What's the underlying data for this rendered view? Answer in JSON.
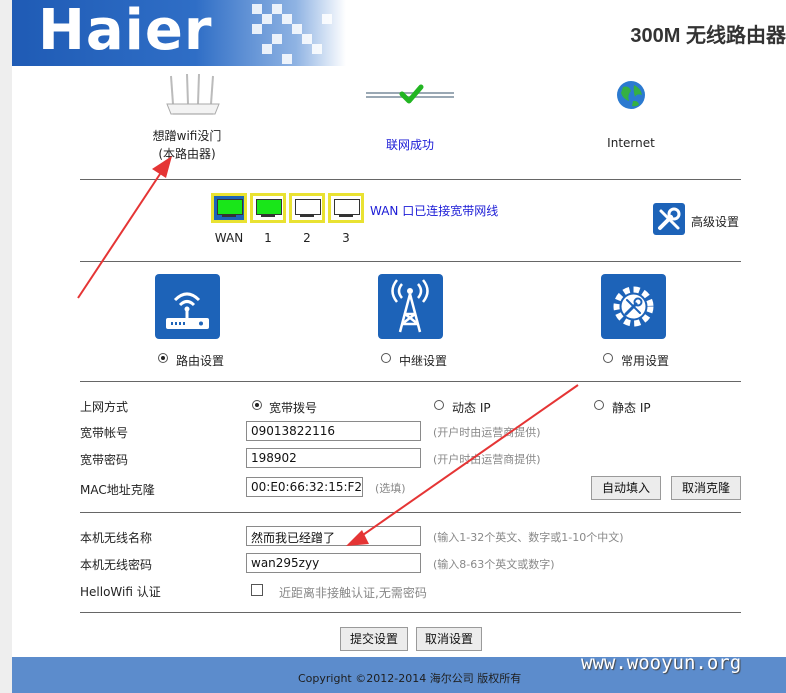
{
  "header": {
    "logo_text": "Haier",
    "product_title": "300M 无线路由器"
  },
  "topology": {
    "router_label_line1": "想蹭wifi没门",
    "router_label_line2": "(本路由器)",
    "status_text": "联网成功",
    "internet_label": "Internet"
  },
  "ports": {
    "items": [
      {
        "label": "WAN",
        "connected": true
      },
      {
        "label": "1",
        "connected": true
      },
      {
        "label": "2",
        "connected": false
      },
      {
        "label": "3",
        "connected": false
      }
    ],
    "status_text": "WAN 口已连接宽带网线",
    "advanced_label": "高级设置"
  },
  "modes": {
    "items": [
      {
        "label": "路由设置",
        "selected": true
      },
      {
        "label": "中继设置",
        "selected": false
      },
      {
        "label": "常用设置",
        "selected": false
      }
    ]
  },
  "wan": {
    "type_label": "上网方式",
    "type_options": [
      {
        "label": "宽带拨号",
        "selected": true
      },
      {
        "label": "动态 IP",
        "selected": false
      },
      {
        "label": "静态 IP",
        "selected": false
      }
    ],
    "account_label": "宽带帐号",
    "account_value": "09013822116",
    "account_hint": "(开户时由运营商提供)",
    "password_label": "宽带密码",
    "password_value": "198902",
    "password_hint": "(开户时由运营商提供)",
    "mac_label": "MAC地址克隆",
    "mac_value": "00:E0:66:32:15:F2",
    "mac_hint": "(选填)",
    "autofill_label": "自动填入",
    "cancel_clone_label": "取消克隆"
  },
  "wireless": {
    "ssid_label": "本机无线名称",
    "ssid_value": "然而我已经蹭了",
    "ssid_hint": "(输入1-32个英文、数字或1-10个中文)",
    "key_label": "本机无线密码",
    "key_value": "wan295zyy",
    "key_hint": "(输入8-63个英文或数字)",
    "hellowifi_label": "HelloWifi 认证",
    "hellowifi_checked": false,
    "hellowifi_text": "近距离非接触认证,无需密码"
  },
  "actions": {
    "submit_label": "提交设置",
    "cancel_label": "取消设置"
  },
  "footer": {
    "copyright": "Copyright ©2012-2014 海尔公司 版权所有",
    "watermark": "www.wooyun.org"
  },
  "colors": {
    "brand_blue": "#1d63b8",
    "port_border": "#e9e232",
    "port_active": "#19e619",
    "link_blue": "#1b1bd6",
    "annotation_red": "#e53535",
    "footer_blue": "#5c8ccc"
  }
}
